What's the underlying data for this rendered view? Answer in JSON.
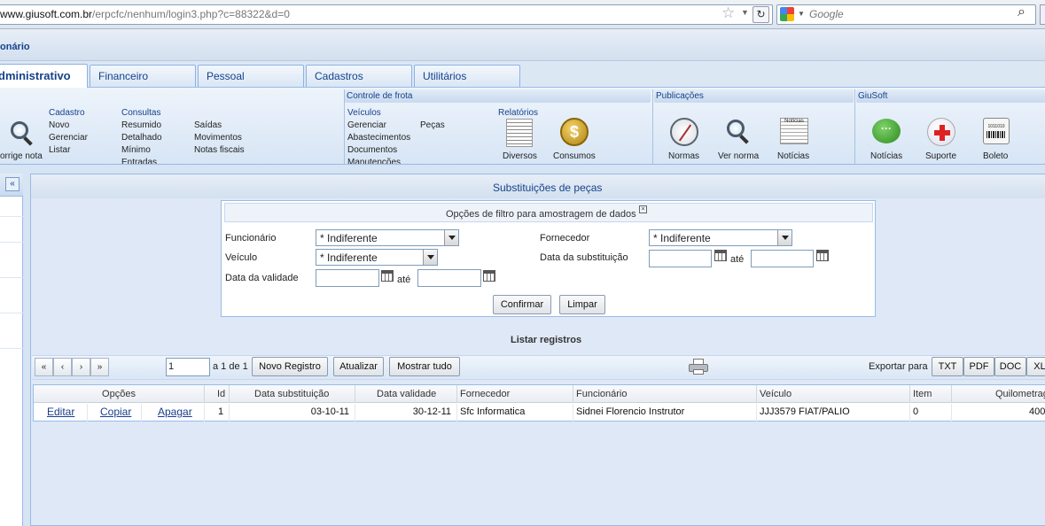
{
  "browser": {
    "url_domain": "www.giusoft.com.br",
    "url_path": "/erpcfc/nenhum/login3.php?c=88322&d=0",
    "search_placeholder": "Google",
    "icons": [
      "star-icon",
      "reload-icon",
      "google-icon",
      "search-icon"
    ]
  },
  "app": {
    "title": "onário"
  },
  "tabs": [
    {
      "label": "dministrativo",
      "active": true
    },
    {
      "label": "Financeiro"
    },
    {
      "label": "Pessoal"
    },
    {
      "label": "Cadastros"
    },
    {
      "label": "Utilitários"
    }
  ],
  "ribbon": {
    "corrige_nota": "orrige nota",
    "cadastro": {
      "title": "Cadastro",
      "items": [
        "Novo",
        "Gerenciar",
        "Listar"
      ]
    },
    "consultas": {
      "title": "Consultas",
      "items": [
        "Resumido",
        "Detalhado",
        "Mínimo",
        "Entradas"
      ]
    },
    "consultas2": {
      "items": [
        "Saídas",
        "Movimentos",
        "Notas fiscais"
      ]
    },
    "controle_frota": {
      "title": "Controle de frota",
      "veiculos_title": "Veículos",
      "veiculos_items": [
        "Gerenciar",
        "Abastecimentos",
        "Documentos",
        "Manutenções"
      ],
      "pecas": "Peças",
      "relatorios_title": "Relatórios",
      "diversos": "Diversos",
      "consumos": "Consumos"
    },
    "publicacoes": {
      "title": "Publicações",
      "normas": "Normas",
      "ver_norma": "Ver norma",
      "noticias": "Notícias",
      "noticias_icon_text": "Notícias"
    },
    "giusoft": {
      "title": "GiuSoft",
      "noticias": "Notícias",
      "suporte": "Suporte",
      "boleto": "Boleto",
      "boleto_icon_text": "1011010"
    }
  },
  "left_panel": {
    "collapse_label": "«"
  },
  "main": {
    "title": "Substituições de peças",
    "filter": {
      "title": "Opções de filtro para amostragem de dados",
      "close": "☒",
      "funcionario_label": "Funcionário",
      "funcionario_value": "* Indiferente",
      "veiculo_label": "Veículo",
      "veiculo_value": "* Indiferente",
      "data_validade_label": "Data da validade",
      "fornecedor_label": "Fornecedor",
      "fornecedor_value": "* Indiferente",
      "data_substituicao_label": "Data da substituição",
      "ate": "até",
      "confirmar": "Confirmar",
      "limpar": "Limpar"
    },
    "list_title": "Listar registros",
    "pager": {
      "first": "«",
      "prev": "‹",
      "next": "›",
      "last": "»",
      "page_value": "1",
      "page_of": "a 1 de 1",
      "novo_registro": "Novo Registro",
      "atualizar": "Atualizar",
      "mostrar_tudo": "Mostrar tudo",
      "exportar_para": "Exportar para",
      "txt": "TXT",
      "pdf": "PDF",
      "doc": "DOC",
      "xls": "XL"
    },
    "grid": {
      "headers": [
        "Opções",
        "Id",
        "Data substituição",
        "Data validade",
        "Fornecedor",
        "Funcionário",
        "Veículo",
        "Item",
        "Quilometrag"
      ],
      "rows": [
        {
          "actions": [
            "Editar",
            "Copiar",
            "Apagar"
          ],
          "id": "1",
          "data_substituicao": "03-10-11",
          "data_validade": "30-12-11",
          "fornecedor": "Sfc Informatica",
          "funcionario": "Sidnei Florencio Instrutor",
          "veiculo": "JJJ3579 FIAT/PALIO",
          "item": "0",
          "quilometragem": "400"
        }
      ]
    }
  }
}
